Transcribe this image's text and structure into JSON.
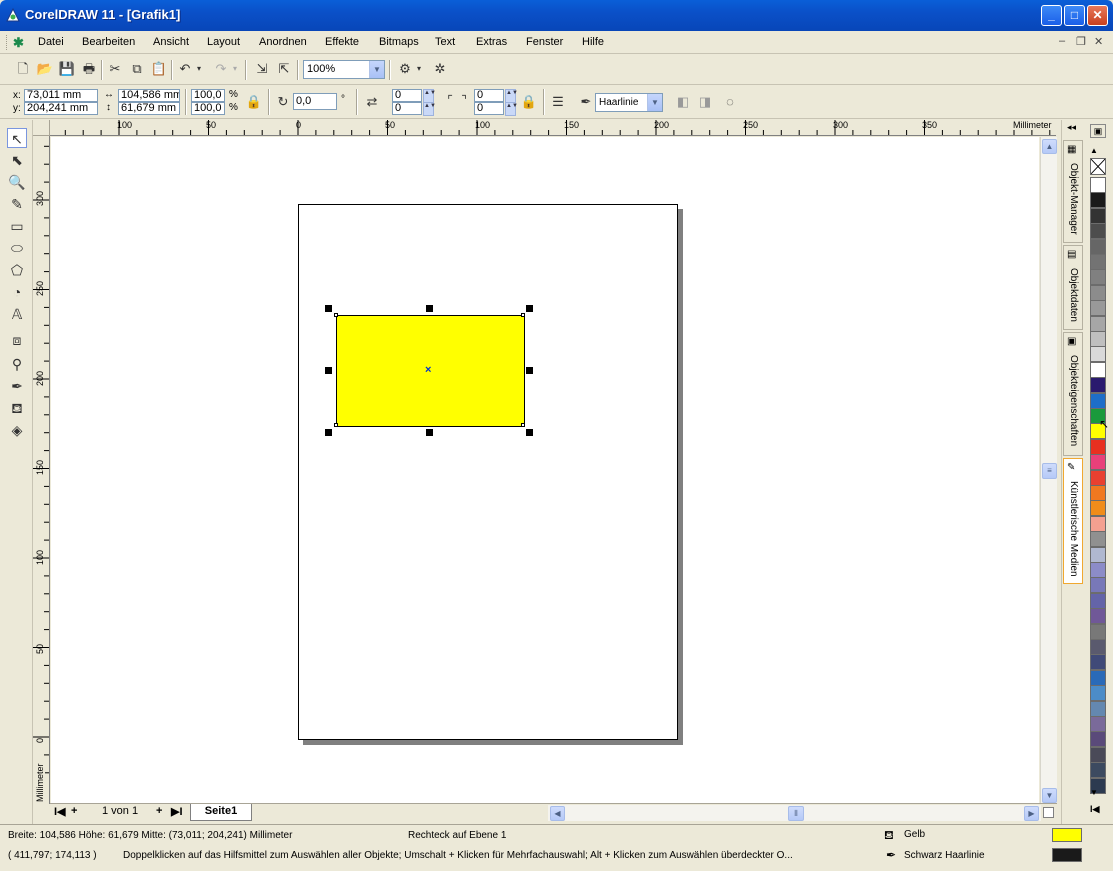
{
  "window": {
    "title": "CorelDRAW 11 - [Grafik1]",
    "minimize": "_",
    "maximize": "□",
    "close": "✕"
  },
  "menu": {
    "items": [
      "Datei",
      "Bearbeiten",
      "Ansicht",
      "Layout",
      "Anordnen",
      "Effekte",
      "Bitmaps",
      "Text",
      "Extras",
      "Fenster",
      "Hilfe"
    ],
    "mdi_min": "–",
    "mdi_restore": "❐",
    "mdi_close": "✕"
  },
  "standard_toolbar": {
    "zoom_value": "100%"
  },
  "property_bar": {
    "x_label": "x:",
    "x_value": "73,011 mm",
    "y_label": "y:",
    "y_value": "204,241 mm",
    "width_value": "104,586 mm",
    "height_value": "61,679 mm",
    "scale_w": "100,0",
    "scale_h": "100,0",
    "percent": "%",
    "rotation_value": "0,0",
    "degree": "°",
    "corner_tl": "0",
    "corner_bl": "0",
    "corner_tr": "0",
    "corner_br": "0",
    "outline_value": "Haarlinie"
  },
  "rulers": {
    "unit": "Millimeter",
    "h_labels": [
      "100",
      "50",
      "0",
      "50",
      "100",
      "150",
      "200",
      "250",
      "300",
      "350"
    ],
    "v_labels": [
      "300",
      "250",
      "200",
      "150",
      "100",
      "50",
      "0"
    ],
    "v_unit": "Millimeter"
  },
  "page_nav": {
    "first": "I◀",
    "add_before": "+",
    "counter": "1 von 1",
    "add_after": "+",
    "last": "▶I",
    "tab": "Seite1"
  },
  "dockers": [
    "Objekt-Manager",
    "Objektdaten",
    "Objekteigenschaften",
    "Künstlerische Medien"
  ],
  "palette": {
    "colors": [
      "#ffffff",
      "#1a1a1a",
      "#333333",
      "#4d4d4d",
      "#666666",
      "#737373",
      "#808080",
      "#8c8c8c",
      "#999999",
      "#a6a6a6",
      "#bfbfbf",
      "#d9d9d9",
      "#ffffff",
      "#2a1a6e",
      "#1e6ec8",
      "#1a9a3c",
      "#ffff00",
      "#e83020",
      "#e8407a",
      "#e84030",
      "#f07820",
      "#f08c1a",
      "#f4a090",
      "#909090",
      "#b0b8d0",
      "#8c8cc8",
      "#7878b8",
      "#6464a8",
      "#705898",
      "#787878",
      "#5a5a6e",
      "#404a78",
      "#2a6ab8",
      "#4c8cc8",
      "#6488b0",
      "#7a6a9a",
      "#5a4a7a",
      "#4a4a58",
      "#3c4a60",
      "#2c3a50"
    ]
  },
  "status": {
    "dimensions": "Breite: 104,586  Höhe: 61,679  Mitte: (73,011; 204,241) Millimeter",
    "object_info": "Rechteck auf Ebene 1",
    "fill_name": "Gelb",
    "fill_color": "#ffff00",
    "coords": "( 411,797; 174,113 )",
    "hint": "Doppelklicken auf das Hilfsmittel zum Auswählen aller Objekte; Umschalt + Klicken für Mehrfachauswahl; Alt + Klicken zum Auswählen überdeckter O...",
    "outline_name": "Schwarz  Haarlinie",
    "outline_color": "#1a1a1a"
  }
}
